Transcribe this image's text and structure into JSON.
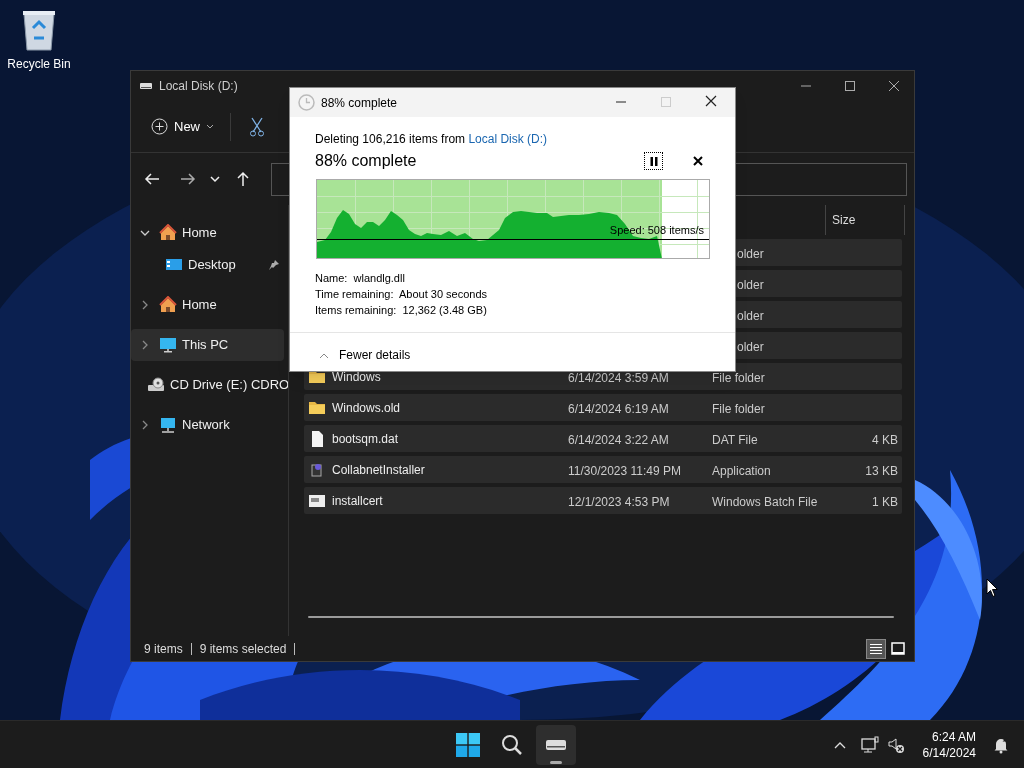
{
  "desktop": {
    "icons": [
      {
        "label": "Recycle Bin"
      }
    ]
  },
  "explorer": {
    "title": "Local Disk (D:)",
    "toolbar": {
      "new_label": "New"
    },
    "sidebar": {
      "items": [
        {
          "label": "Home",
          "kind": "home",
          "expanded": true,
          "selected": false,
          "children": [
            {
              "label": "Desktop",
              "kind": "desktop",
              "pinned": true,
              "selected": false
            }
          ]
        },
        {
          "label": "Home",
          "kind": "home",
          "expanded": false,
          "selected": false
        },
        {
          "label": "This PC",
          "kind": "pc",
          "expanded": false,
          "selected": true
        },
        {
          "label": "CD Drive (E:) CDRO",
          "kind": "cd",
          "expanded": false,
          "selected": false
        },
        {
          "label": "Network",
          "kind": "network",
          "expanded": false,
          "selected": false
        }
      ]
    },
    "columns": [
      {
        "label": "Size"
      }
    ],
    "rows": [
      {
        "type": "older",
        "selected": true
      },
      {
        "type": "older",
        "selected": true
      },
      {
        "type": "older",
        "selected": true
      },
      {
        "type": "older",
        "selected": true
      },
      {
        "kind": "folder",
        "name": "Windows",
        "date": "6/14/2024 3:59 AM",
        "type": "File folder",
        "selected": true
      },
      {
        "kind": "folder",
        "name": "Windows.old",
        "date": "6/14/2024 6:19 AM",
        "type": "File folder",
        "selected": true
      },
      {
        "kind": "file",
        "name": "bootsqm.dat",
        "date": "6/14/2024 3:22 AM",
        "type": "DAT File",
        "size": "4 KB",
        "selected": true
      },
      {
        "kind": "app",
        "name": "CollabnetInstaller",
        "date": "11/30/2023 11:49 PM",
        "type": "Application",
        "size": "13 KB",
        "selected": true
      },
      {
        "kind": "batch",
        "name": "installcert",
        "date": "12/1/2023 4:53 PM",
        "type": "Windows Batch File",
        "size": "1 KB",
        "selected": true
      }
    ],
    "status_bar": {
      "count": "9 items",
      "selection": "9 items selected"
    },
    "view": [
      {
        "kind": "details",
        "selected": true
      },
      {
        "kind": "tiles",
        "selected": false
      }
    ]
  },
  "dialog": {
    "title": "88% complete",
    "summary_prefix": "Deleting 106,216 items from ",
    "summary_link": "Local Disk (D:)",
    "heading": "88% complete",
    "level": 0.88,
    "speed": "Speed: 508 items/s",
    "details": [
      {
        "label": "Name:",
        "value": "wlandlg.dll"
      },
      {
        "label": "Time remaining:",
        "value": "About 30 seconds"
      },
      {
        "label": "Items remaining:",
        "value": "12,362 (3.48 GB)"
      }
    ],
    "toggle": "Fewer details"
  },
  "taskbar": {
    "apps": [
      {
        "kind": "start",
        "active": false
      },
      {
        "kind": "search",
        "active": false
      },
      {
        "kind": "explorer",
        "active": true
      }
    ],
    "time": "6:24 AM",
    "date": "6/14/2024"
  }
}
